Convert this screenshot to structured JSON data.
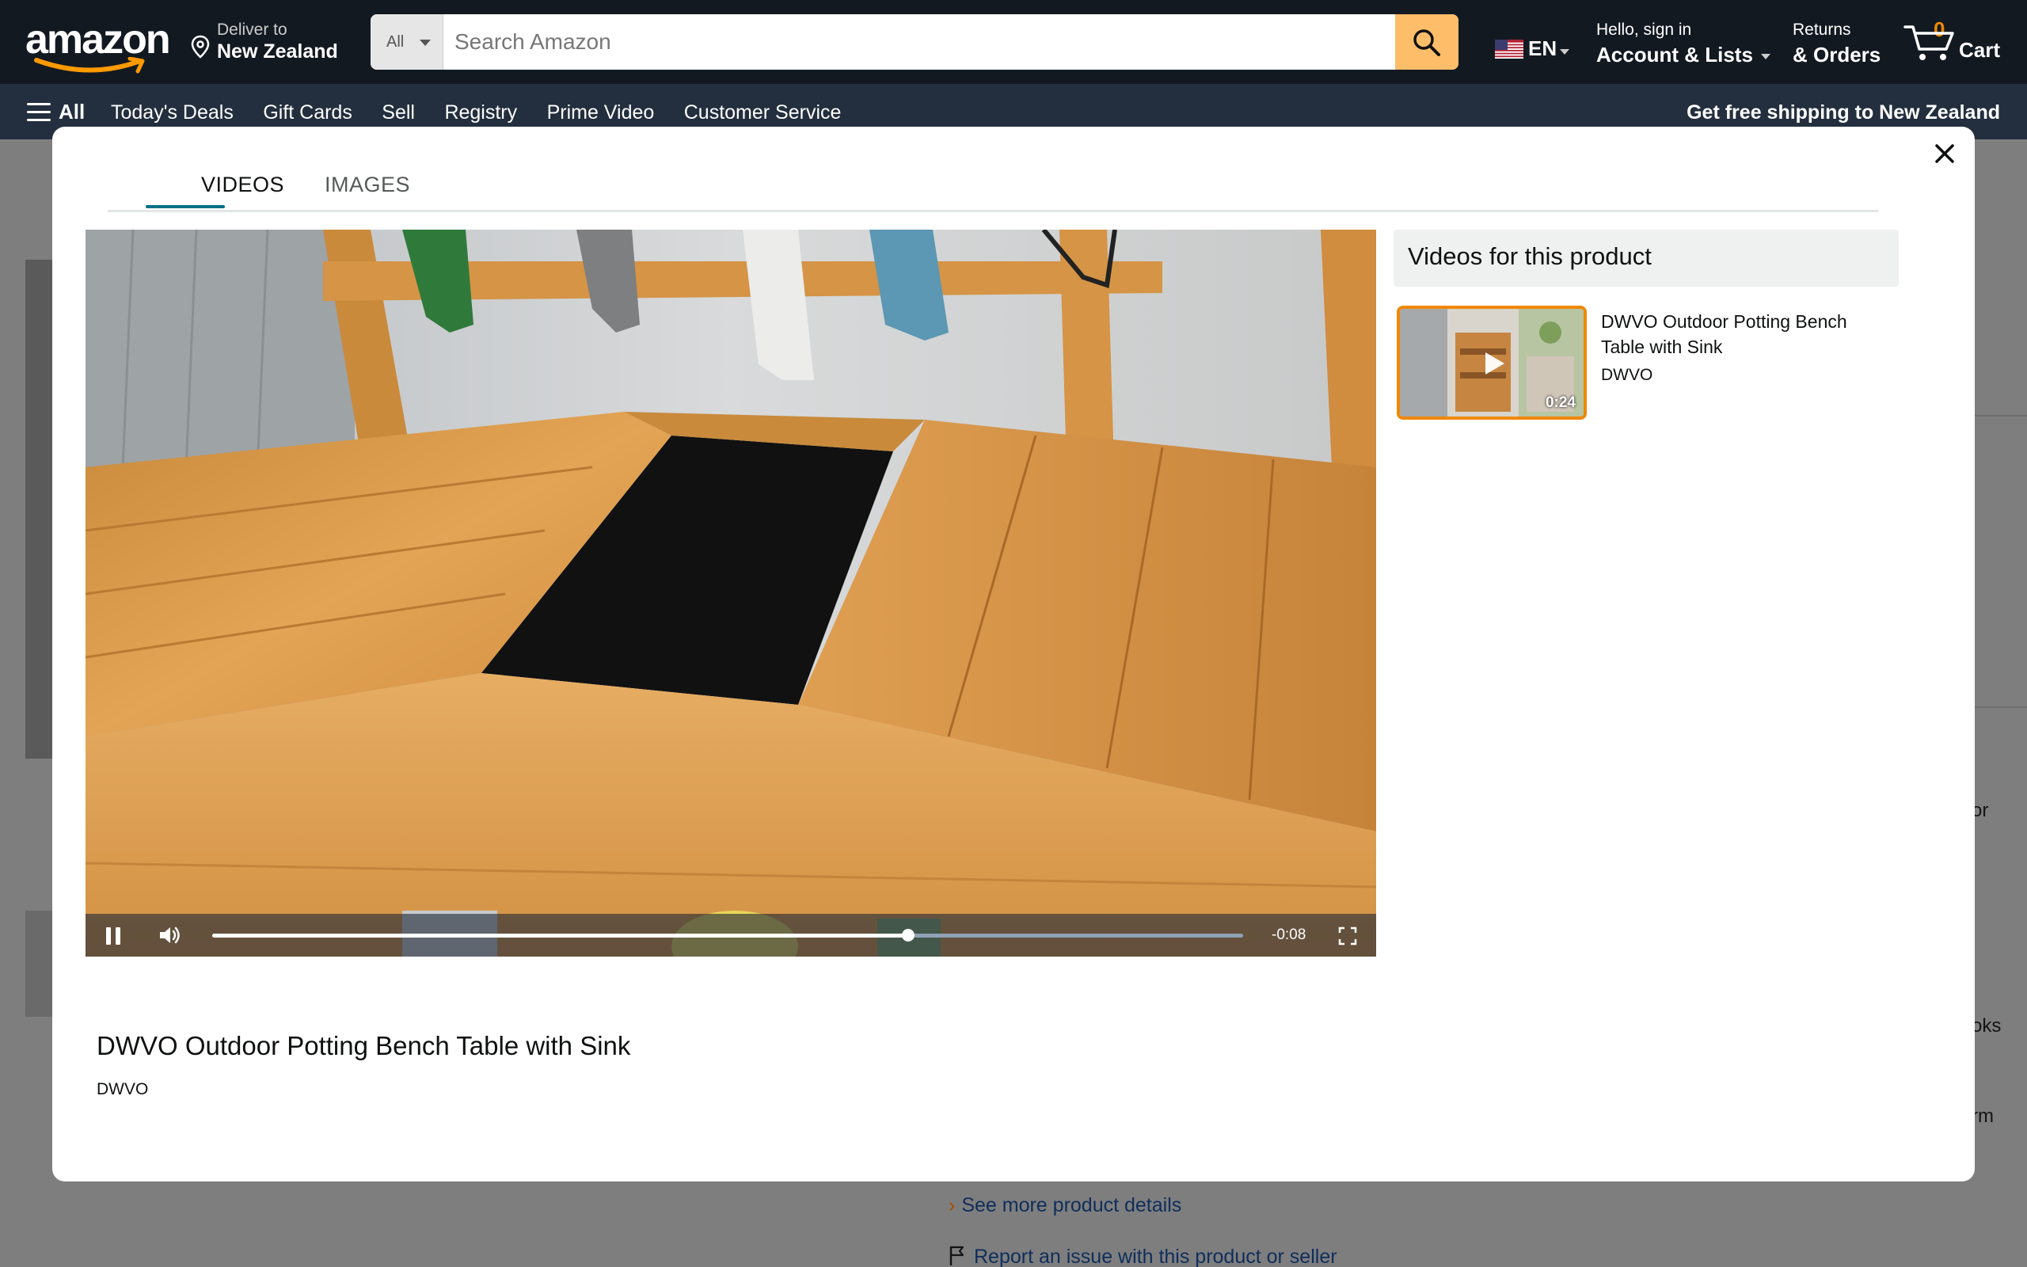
{
  "header": {
    "logo_text": "amazon",
    "deliver_label": "Deliver to",
    "deliver_location": "New Zealand",
    "search": {
      "category": "All",
      "placeholder": "Search Amazon",
      "value": ""
    },
    "language": "EN",
    "account_greeting": "Hello, sign in",
    "account_label": "Account & Lists",
    "returns_label": "Returns",
    "orders_label": "& Orders",
    "cart_count": "0",
    "cart_label": "Cart"
  },
  "subnav": {
    "all_label": "All",
    "links": [
      "Today's Deals",
      "Gift Cards",
      "Sell",
      "Registry",
      "Prime Video",
      "Customer Service"
    ],
    "shipping_promo": "Get free shipping to New Zealand"
  },
  "background_page": {
    "fragments": [
      "or",
      "oks",
      "rm"
    ],
    "see_more_link": "See more product details",
    "report_link": "Report an issue with this product or seller"
  },
  "modal": {
    "tabs": [
      {
        "label": "VIDEOS",
        "active": true
      },
      {
        "label": "IMAGES",
        "active": false
      }
    ],
    "player": {
      "playing": true,
      "progress_fraction": 0.675,
      "time_remaining": "-0:08"
    },
    "video_title": "DWVO Outdoor Potting Bench Table with Sink",
    "video_brand": "DWVO",
    "sidebar": {
      "heading": "Videos for this product",
      "videos": [
        {
          "title": "DWVO Outdoor Potting Bench Table with Sink",
          "brand": "DWVO",
          "duration": "0:24",
          "selected": true
        }
      ]
    }
  },
  "colors": {
    "nav_dark": "#131921",
    "subnav": "#232f3e",
    "search_button": "#febd69",
    "accent_orange": "#f08804",
    "tab_underline": "#007185",
    "link_blue": "#007185"
  }
}
